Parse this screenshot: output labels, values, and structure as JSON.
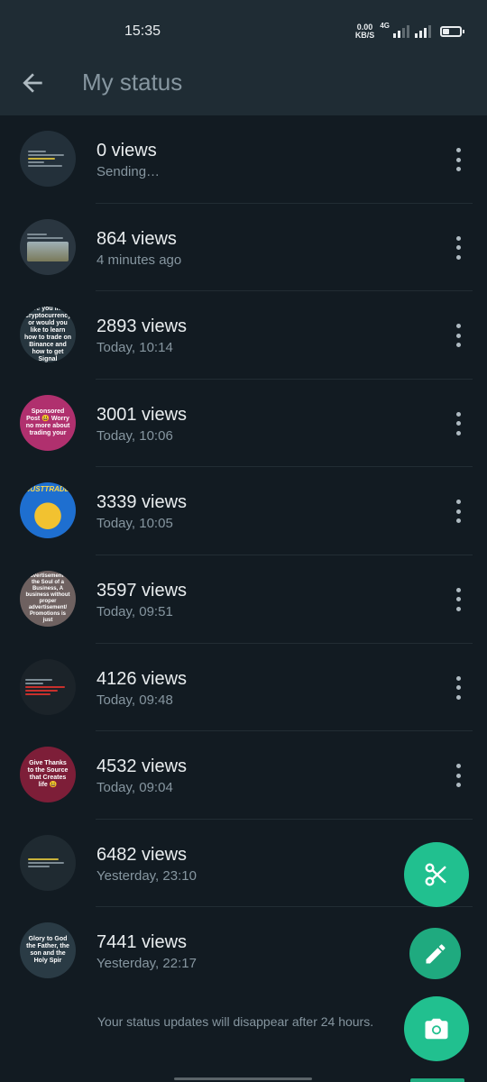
{
  "status_bar": {
    "time": "15:35",
    "speed_value": "0.00",
    "speed_unit": "KB/S",
    "network": "4G"
  },
  "app_bar": {
    "back_icon": "arrow-left-icon",
    "title": "My status"
  },
  "statuses": [
    {
      "views": "0 views",
      "time": "Sending…",
      "thumb_text": ""
    },
    {
      "views": "864 views",
      "time": "4 minutes ago",
      "thumb_text": ""
    },
    {
      "views": "2893 views",
      "time": "Today, 10:14",
      "thumb_text": "Are you into Cryptocurrency or would you like to learn how to trade on Binance and how to get Signal"
    },
    {
      "views": "3001 views",
      "time": "Today, 10:06",
      "thumb_text": "Sponsored Post 😃 Worry no more about trading your"
    },
    {
      "views": "3339 views",
      "time": "Today, 10:05",
      "thumb_text": "JUSTTRADE"
    },
    {
      "views": "3597 views",
      "time": "Today, 09:51",
      "thumb_text": "Advertisement is the Soul of a Business, A business without proper advertisement/ Promotions is just"
    },
    {
      "views": "4126 views",
      "time": "Today, 09:48",
      "thumb_text": ""
    },
    {
      "views": "4532 views",
      "time": "Today, 09:04",
      "thumb_text": "Give Thanks to the Source that Creates life 😃"
    },
    {
      "views": "6482 views",
      "time": "Yesterday, 23:10",
      "thumb_text": ""
    },
    {
      "views": "7441 views",
      "time": "Yesterday, 22:17",
      "thumb_text": "Glory to God the Father, the son and the Holy Spir"
    }
  ],
  "footer": "Your status updates will disappear after 24 hours.",
  "fabs": {
    "cut_icon": "scissors-icon",
    "edit_icon": "pencil-icon",
    "camera_icon": "camera-icon"
  },
  "colors": {
    "background": "#121b22",
    "app_bar": "#1f2c34",
    "accent": "#21c08f",
    "secondary_text": "#8696a0"
  }
}
